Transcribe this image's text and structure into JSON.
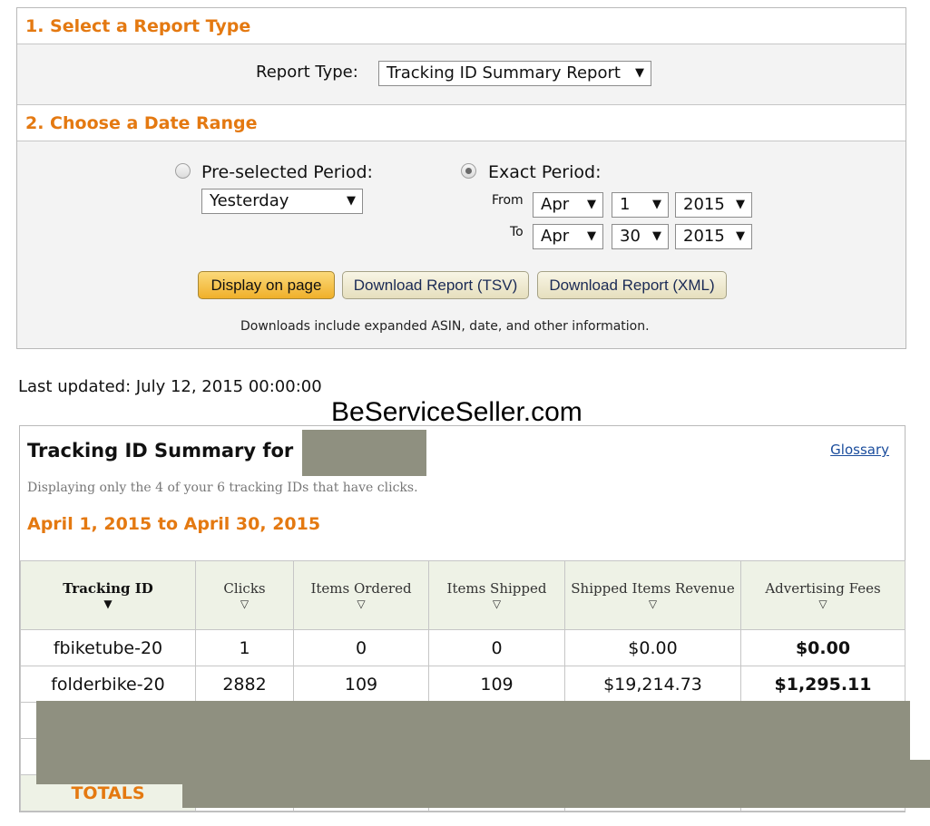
{
  "section1": {
    "title": "1. Select a Report Type",
    "report_type_label": "Report Type:",
    "report_type_value": "Tracking ID Summary Report"
  },
  "section2": {
    "title": "2. Choose a Date Range",
    "preselected_label": "Pre-selected Period:",
    "preselected_value": "Yesterday",
    "exact_label": "Exact Period:",
    "from_label": "From",
    "to_label": "To",
    "from": {
      "month": "Apr",
      "day": "1",
      "year": "2015"
    },
    "to": {
      "month": "Apr",
      "day": "30",
      "year": "2015"
    },
    "selected_option": "Exact Period"
  },
  "buttons": {
    "display": "Display on page",
    "tsv": "Download Report (TSV)",
    "xml": "Download Report (XML)"
  },
  "note": "Downloads include expanded ASIN, date, and other information.",
  "last_updated": "Last updated: July 12, 2015 00:00:00",
  "watermark": "BeServiceSeller.com",
  "summary": {
    "title": "Tracking ID Summary for",
    "glossary": "Glossary",
    "subtitle": "Displaying only the 4 of your 6 tracking IDs that have clicks.",
    "range": "April 1, 2015 to April 30, 2015"
  },
  "table": {
    "headers": [
      "Tracking ID",
      "Clicks",
      "Items Ordered",
      "Items Shipped",
      "Shipped Items Revenue",
      "Advertising Fees"
    ],
    "rows": [
      [
        "fbiketube-20",
        "1",
        "0",
        "0",
        "$0.00",
        "$0.00"
      ],
      [
        "folderbike-20",
        "2882",
        "109",
        "109",
        "$19,214.73",
        "$1,295.11"
      ]
    ],
    "totals_label": "TOTALS"
  },
  "icons": {
    "select_arrow": "▼",
    "sort_active": "▼",
    "sort_inactive": "▽"
  },
  "colors": {
    "accent": "#e47911",
    "redaction": "#8f9080",
    "header_bg": "#eef2e6"
  }
}
